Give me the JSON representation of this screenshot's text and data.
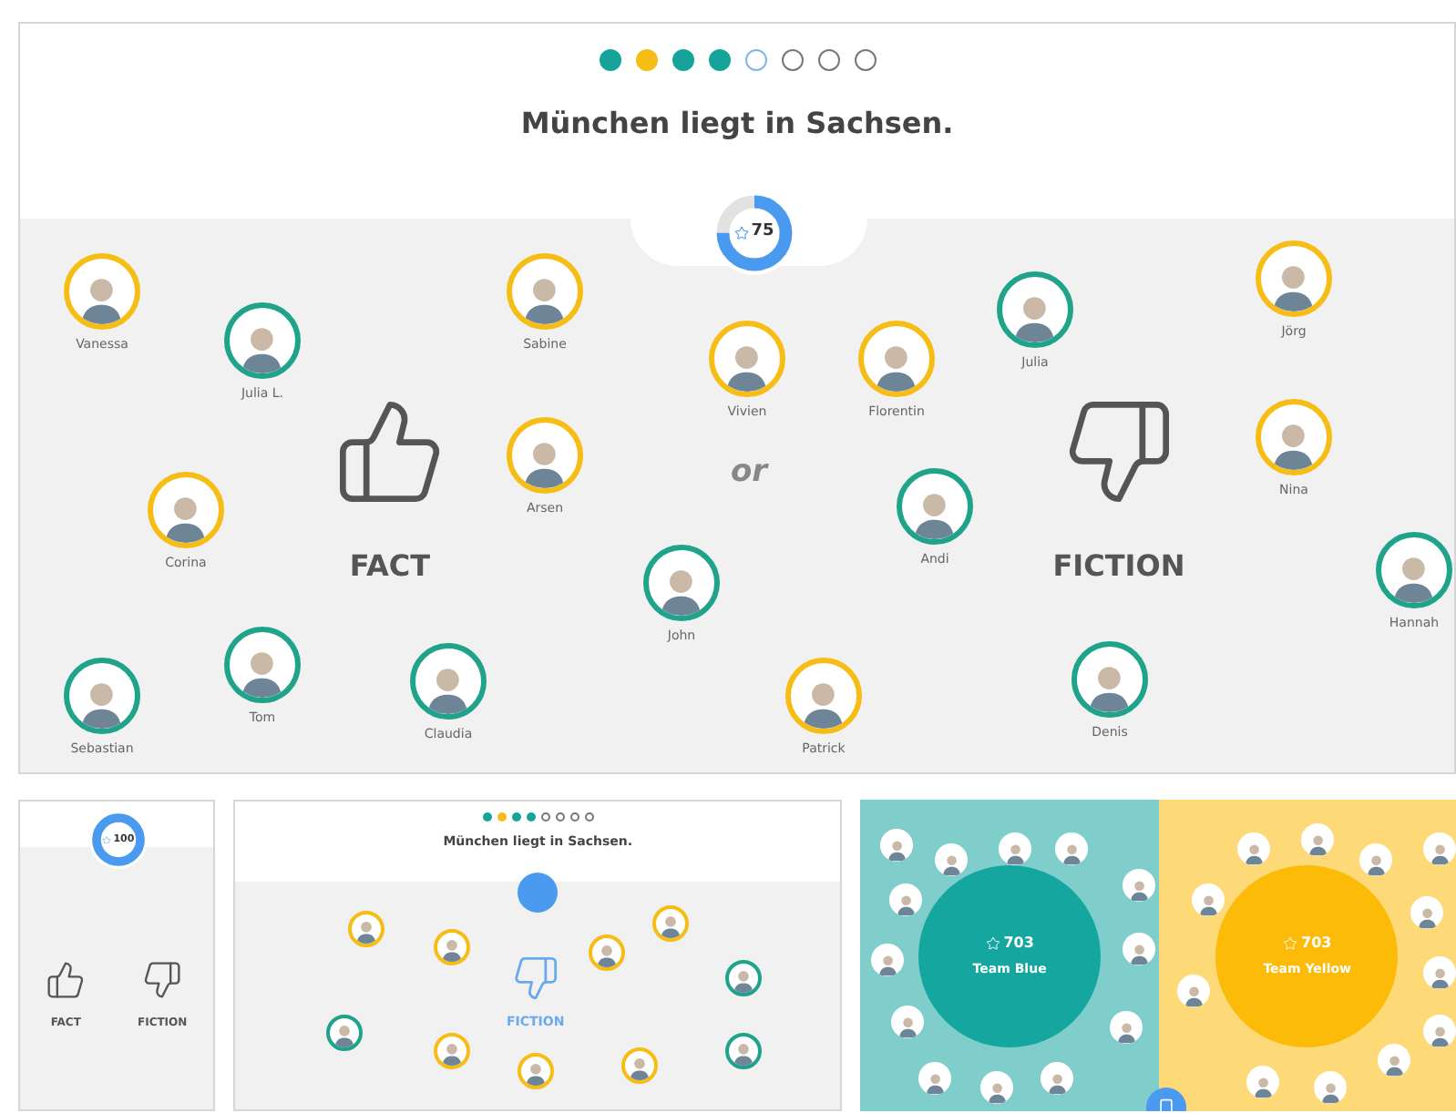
{
  "progress": [
    {
      "kind": "answered",
      "color": "#16a39a"
    },
    {
      "kind": "answered",
      "color": "#f6bd16"
    },
    {
      "kind": "answered",
      "color": "#16a39a"
    },
    {
      "kind": "answered",
      "color": "#16a39a"
    },
    {
      "kind": "current"
    },
    {
      "kind": "pending"
    },
    {
      "kind": "pending"
    },
    {
      "kind": "pending"
    }
  ],
  "question": "München liegt in Sachsen.",
  "timer": {
    "reading": "75",
    "level": 0.75
  },
  "fact": "FACT",
  "or": "or",
  "fiction": "FICTION",
  "players": [
    {
      "name": "Vanessa",
      "color": "#f6bd16"
    },
    {
      "name": "Julia L.",
      "color": "#1fa38a"
    },
    {
      "name": "Sabine",
      "color": "#f6bd16"
    },
    {
      "name": "Vivien",
      "color": "#f6bd16"
    },
    {
      "name": "Florentin",
      "color": "#f6bd16"
    },
    {
      "name": "Julia",
      "color": "#1fa38a"
    },
    {
      "name": "Jörg",
      "color": "#f6bd16"
    },
    {
      "name": "Arsen",
      "color": "#f6bd16"
    },
    {
      "name": "Corina",
      "color": "#f6bd16"
    },
    {
      "name": "Andi",
      "color": "#1fa38a"
    },
    {
      "name": "Nina",
      "color": "#f6bd16"
    },
    {
      "name": "John",
      "color": "#1fa38a"
    },
    {
      "name": "Hannah",
      "color": "#1fa38a"
    },
    {
      "name": "Sebastian",
      "color": "#1fa38a"
    },
    {
      "name": "Tom",
      "color": "#1fa38a"
    },
    {
      "name": "Claudia",
      "color": "#1fa38a"
    },
    {
      "name": "Patrick",
      "color": "#f6bd16"
    },
    {
      "name": "Denis",
      "color": "#1fa38a"
    }
  ],
  "phone_view": {
    "timer": {
      "reading": "100",
      "level": 1
    },
    "fact": "FACT",
    "fiction": "FICTION"
  },
  "result_view": {
    "progress": [
      {
        "kind": "answered",
        "color": "#16a39a"
      },
      {
        "kind": "answered",
        "color": "#f6bd16"
      },
      {
        "kind": "answered",
        "color": "#16a39a"
      },
      {
        "kind": "answered",
        "color": "#16a39a"
      },
      {
        "kind": "pending"
      },
      {
        "kind": "pending"
      },
      {
        "kind": "pending"
      },
      {
        "kind": "pending"
      }
    ],
    "question": "München liegt in Sachsen.",
    "answer": "FICTION",
    "players": [
      {
        "color": "#f6bd16"
      },
      {
        "color": "#f6bd16"
      },
      {
        "color": "#f6bd16"
      },
      {
        "color": "#f6bd16"
      },
      {
        "color": "#1fa38a"
      },
      {
        "color": "#1fa38a"
      },
      {
        "color": "#f6bd16"
      },
      {
        "color": "#f6bd16"
      },
      {
        "color": "#f6bd16"
      },
      {
        "color": "#1fa38a"
      }
    ]
  },
  "teams_view": {
    "teams": [
      {
        "name": "Team Blue",
        "score": "703",
        "color": "#16a6a0"
      },
      {
        "name": "Team Yellow",
        "score": "703",
        "color": "#fcbb08"
      }
    ]
  }
}
